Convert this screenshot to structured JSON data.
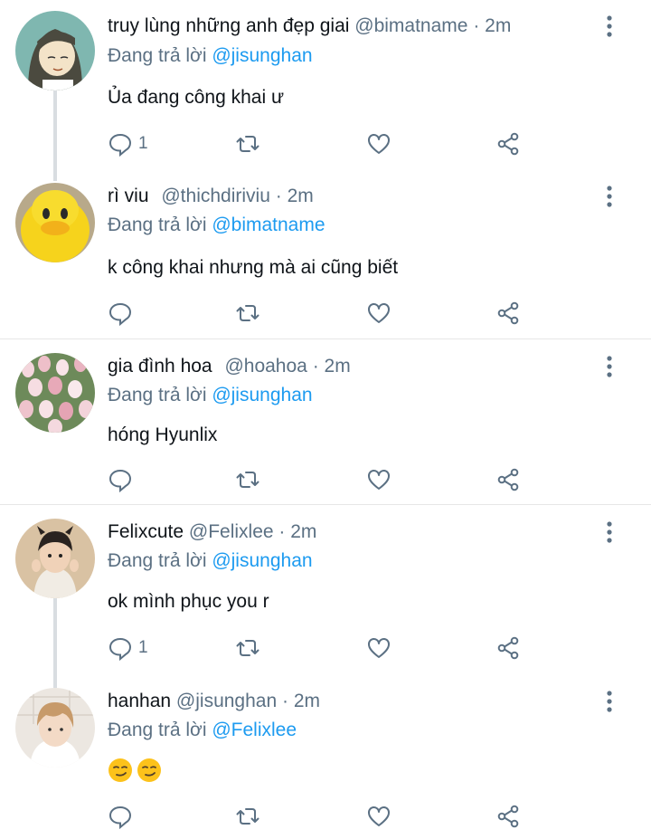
{
  "reply_prefix": "Đang trả lời",
  "colors": {
    "mention": "#1d9bf0",
    "secondary": "#5b7083",
    "text": "#0f1419",
    "separator": "#e6e6e6"
  },
  "tweets": [
    {
      "name": "truy lùng những anh đẹp giai",
      "handle": "@bimatname",
      "dot": "·",
      "time": "2m",
      "reply_to": "@jisunghan",
      "text": "Ủa đang công khai ư",
      "reply_count": "1",
      "avatar_icon": "avatar-drawn-girl"
    },
    {
      "name": "rì viu",
      "handle": "@thichdiriviu",
      "dot": "·",
      "time": "2m",
      "reply_to": "@bimatname",
      "text": "k công khai nhưng mà ai cũng biết",
      "reply_count": "",
      "avatar_icon": "avatar-yellow-duck"
    },
    {
      "name": "gia đình hoa",
      "handle": "@hoahoa",
      "dot": "·",
      "time": "2m",
      "reply_to": "@jisunghan",
      "text": "hóng Hyunlix",
      "reply_count": "",
      "avatar_icon": "avatar-tulips"
    },
    {
      "name": "Felixcute",
      "handle": "@Felixlee",
      "dot": "·",
      "time": "2m",
      "reply_to": "@jisunghan",
      "text": "ok mình phục you r",
      "reply_count": "1",
      "avatar_icon": "avatar-boy-photo"
    },
    {
      "name": "hanhan",
      "handle": "@jisunghan",
      "dot": "·",
      "time": "2m",
      "reply_to": "@Felixlee",
      "text": "",
      "emojis": [
        "smirking-face-emoji",
        "smirking-face-emoji"
      ],
      "reply_count": "",
      "avatar_icon": "avatar-selfie-photo"
    }
  ],
  "icons": {
    "reply": "reply-bubble-icon",
    "retweet": "retweet-icon",
    "like": "heart-icon",
    "share": "share-icon",
    "more": "more-vertical-icon"
  }
}
